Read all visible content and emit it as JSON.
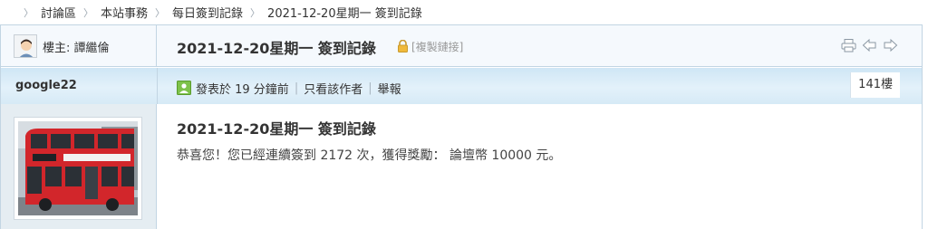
{
  "breadcrumb": {
    "items": [
      "討論區",
      "本站事務",
      "每日簽到記錄",
      "2021-12-20星期一 簽到記錄"
    ]
  },
  "thread": {
    "host_label": "樓主: 譚繼倫",
    "title": "2021-12-20星期一 簽到記錄",
    "copy_link": "[複製鏈接]"
  },
  "post": {
    "author": "google22",
    "posted": "發表於 19 分鐘前",
    "only_author": "只看該作者",
    "report": "舉報",
    "floor": "141樓",
    "title": "2021-12-20星期一 簽到記錄",
    "body": "恭喜您！您已經連續簽到 2172 次，獲得獎勵： 論壇幣 10000 元。"
  },
  "icons": {
    "lock": "lock-icon",
    "print": "print-icon",
    "prev": "prev-thread-icon",
    "next": "next-thread-icon",
    "online": "online-status-icon"
  },
  "colors": {
    "border": "#c2d5e3",
    "author_bar": "#d6eaf6",
    "sidebar_bg": "#e5edf2",
    "bus_red": "#d2262b"
  }
}
